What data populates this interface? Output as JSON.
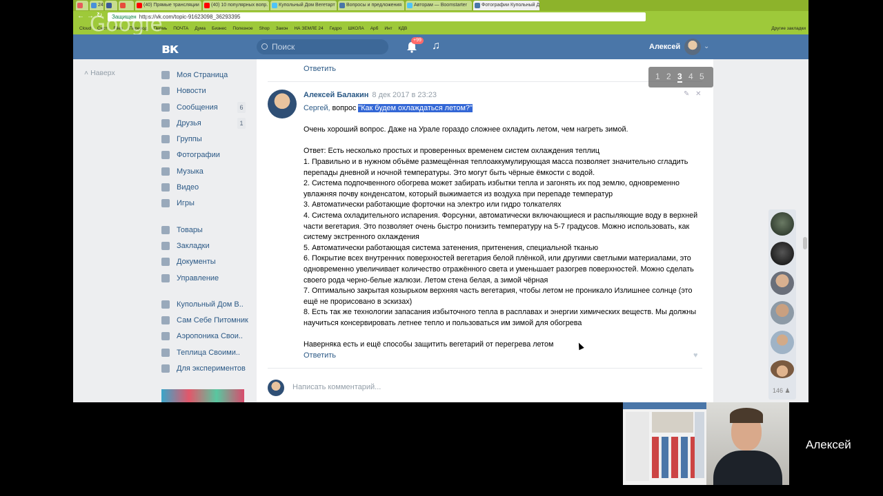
{
  "browser": {
    "tabs": [
      {
        "label": "",
        "color": "#e65c5c"
      },
      {
        "label": "24",
        "color": "#4a90d9"
      },
      {
        "label": "",
        "color": "#3b5998"
      },
      {
        "label": "",
        "color": "#e74c3c"
      },
      {
        "label": "(40) Прямые трансляции",
        "color": "#ff0000"
      },
      {
        "label": "(40) 10 популярных вопр.",
        "color": "#ff0000"
      },
      {
        "label": "Купольный Дом Вегетарт",
        "color": "#4fc3f7"
      },
      {
        "label": "Вопросы и предложения",
        "color": "#4a76a8"
      },
      {
        "label": "Авторам — Boomstarter",
        "color": "#4fc3f7"
      },
      {
        "label": "Фотографии Купольный Д",
        "color": "#4a76a8"
      }
    ],
    "secure_label": "Защищен",
    "url": "https://vk.com/topic-91623098_36293395",
    "bookmarks": [
      "Cloud",
      "Cист",
      "Files",
      "Перевод",
      "Пермь",
      "ПОЧТА",
      "Дума",
      "Бизнес",
      "Полезное",
      "Shop",
      "Закон",
      "НА ЗЕМЛЕ 24",
      "Гидро",
      "ШКОЛА",
      "Арб",
      "Инт",
      "КДВ",
      "Другие закладки"
    ],
    "google_watermark": "Google"
  },
  "vk_header": {
    "logo": "вк",
    "search_placeholder": "Поиск",
    "notif_badge": "+99",
    "music_icon": "♫",
    "username": "Алексей",
    "chevron": "⌄"
  },
  "left_nav": {
    "back_label": "Наверх",
    "items": [
      {
        "label": "Моя Страница",
        "count": ""
      },
      {
        "label": "Новости",
        "count": ""
      },
      {
        "label": "Сообщения",
        "count": "6"
      },
      {
        "label": "Друзья",
        "count": "1"
      },
      {
        "label": "Группы",
        "count": ""
      },
      {
        "label": "Фотографии",
        "count": ""
      },
      {
        "label": "Музыка",
        "count": ""
      },
      {
        "label": "Видео",
        "count": ""
      },
      {
        "label": "Игры",
        "count": ""
      }
    ],
    "items2": [
      {
        "label": "Товары"
      },
      {
        "label": "Закладки"
      },
      {
        "label": "Документы"
      },
      {
        "label": "Управление"
      }
    ],
    "groups": [
      {
        "label": "Купольный Дом В.."
      },
      {
        "label": "Сам Себе Питомник"
      },
      {
        "label": "Аэропоника Свои.."
      },
      {
        "label": "Теплица Своими.."
      },
      {
        "label": "Для экспериментов"
      }
    ]
  },
  "post": {
    "prev_reply_label": "Ответить",
    "author": "Алексей Балакин",
    "date": "8 дек 2017 в 23:23",
    "addressee": "Сергей,",
    "question_prefix": "вопрос",
    "question_highlight": "\"Как будем охлаждаться летом?\"",
    "intro": "Очень хороший вопрос. Даже на Урале гораздо сложнее охладить летом, чем нагреть зимой.",
    "answer_header": "Ответ: Есть несколько простых и проверенных временем систем охлаждения теплиц",
    "points": [
      "1. Правильно и в нужном объёме размещённая теплоаккумулирующая масса позволяет значительно сгладить перепады дневной и ночной температуры. Это могут быть чёрные ёмкости с водой.",
      "2. Система подпочвенного обогрева может забирать избытки тепла и загонять их под землю, одновременно увлажняя почву конденсатом, который выжимается из воздуха при перепаде температур",
      "3. Автоматически работающие форточки на электро или гидро толкателях",
      "4. Система охладительного испарения. Форсунки, автоматически включающиеся и распыляющие воду в верхней части вегетария. Это позволяет очень быстро понизить температуру на 5-7 градусов. Можно использовать, как систему экстренного охлаждения",
      "5. Автоматически работающая система затенения, притенения, специальной тканью",
      "6. Покрытие всех внутренних поверхностей вегетария белой плёнкой, или другими светлыми материалами, это одновременно увеличивает количество отражённого света и уменьшает разогрев поверхностей. Можно сделать своего рода черно-белые жалюзи. Летом стена белая, а зимой чёрная",
      "7. Оптимально закрытая козырьком верхняя часть вегетария, чтобы летом не проникало Излишнее солнце (это ещё не прорисовано в эскизах)",
      "8. Есть так же технологии запасания избыточного тепла в расплавах и энергии химических веществ. Мы должны научиться консервировать летнее тепло и пользоваться им зимой для обогрева"
    ],
    "conclusion": "Наверняка есть и ещё способы защитить вегетарий от перегрева летом",
    "reply_label": "Ответить",
    "comment_placeholder": "Написать комментарий..."
  },
  "pager": {
    "pages": [
      "1",
      "2",
      "3",
      "4",
      "5"
    ],
    "current": "3"
  },
  "online": {
    "count": "146"
  },
  "webcam": {
    "name": "Алексей"
  }
}
